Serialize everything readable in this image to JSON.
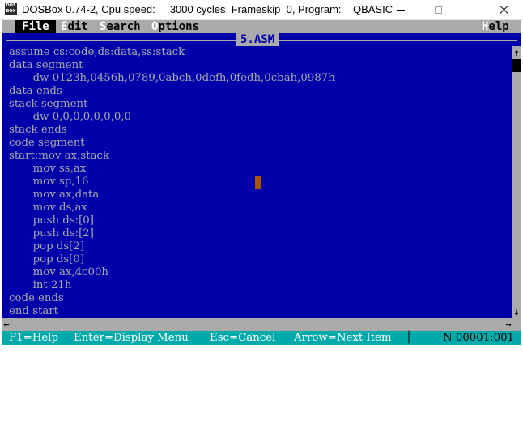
{
  "window": {
    "icon_text": "DOS BOX",
    "title": "DOSBox 0.74-2, Cpu speed:     3000 cycles, Frameskip  0, Program:    QBASIC",
    "minimize_icon": "minimize-icon",
    "maximize_icon": "maximize-icon",
    "close_icon": "close-icon"
  },
  "menu": {
    "file": {
      "hotkey": "F",
      "rest": "ile"
    },
    "edit": {
      "hotkey": "E",
      "rest": "dit"
    },
    "search": {
      "hotkey": "S",
      "rest": "earch"
    },
    "options": {
      "hotkey": "O",
      "rest": "ptions"
    },
    "help": {
      "hotkey": "H",
      "rest": "elp"
    }
  },
  "editor": {
    "filename": "5.ASM",
    "lines": [
      "assume cs:code,ds:data,ss:stack",
      "data segment",
      "       dw 0123h,0456h,0789,0abch,0defh,0fedh,0cbah,0987h",
      "data ends",
      "stack segment",
      "       dw 0,0,0,0,0,0,0,0",
      "stack ends",
      "code segment",
      "start:mov ax,stack",
      "       mov ss,ax",
      "       mov sp,16",
      "       mov ax,data",
      "       mov ds,ax",
      "       push ds:[0]",
      "       push ds:[2]",
      "       pop ds[2]",
      "       pop ds[0]",
      "       mov ax,4c00h",
      "       int 21h",
      "code ends",
      "end start"
    ],
    "scroll_up": "↑",
    "scroll_down": "↓",
    "scroll_left": "←",
    "scroll_right": "→"
  },
  "status": {
    "help": "F1=Help",
    "enter": "Enter=Display Menu",
    "esc": "Esc=Cancel",
    "arrow": "Arrow=Next Item",
    "separator": "│",
    "position": "N 00001:001"
  },
  "colors": {
    "dos_blue": "#0000aa",
    "dos_gray": "#aaaaaa",
    "dos_cyan": "#00aaaa",
    "cursor": "#aa5500"
  }
}
